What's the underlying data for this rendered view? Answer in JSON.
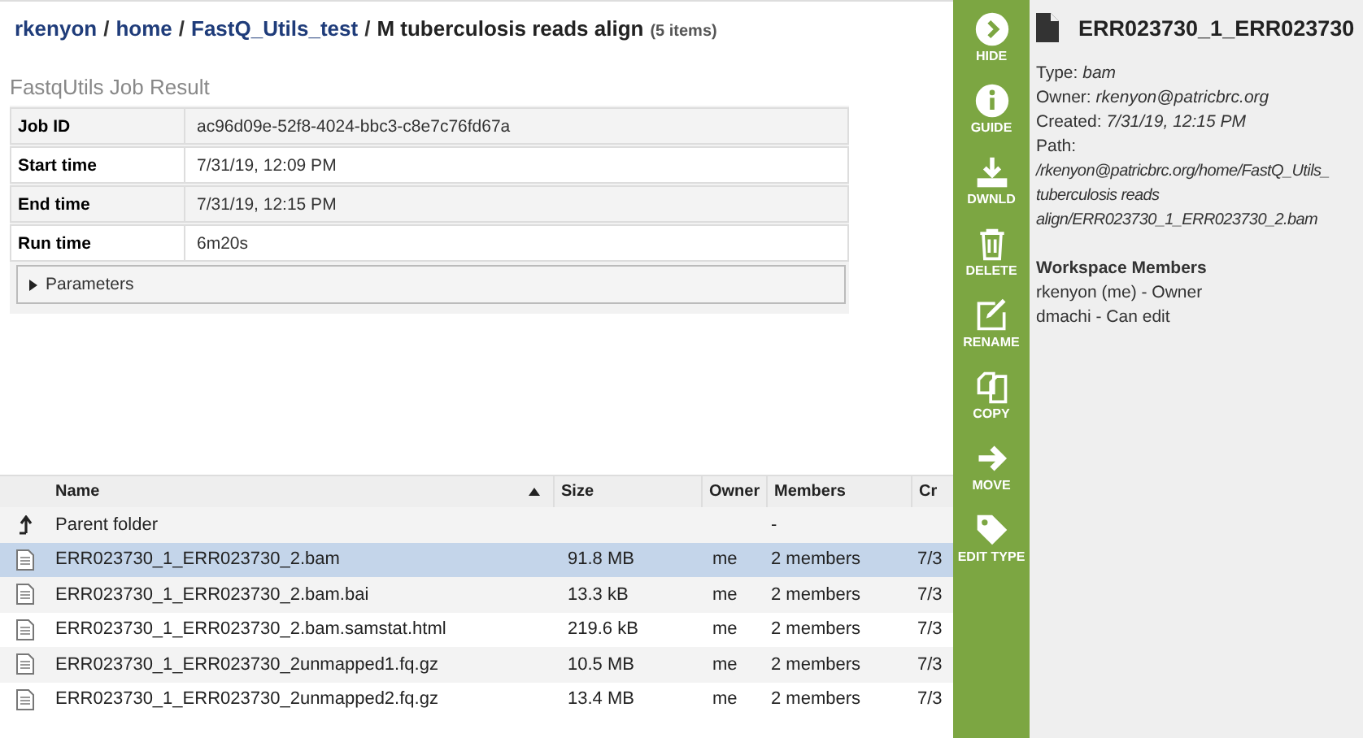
{
  "breadcrumb": {
    "separator": "/",
    "links": [
      "rkenyon",
      "home",
      "FastQ_Utils_test"
    ],
    "current": "M tuberculosis reads align",
    "count": "(5 items)"
  },
  "job_result": {
    "title": "FastqUtils Job Result",
    "rows": [
      {
        "label": "Job ID",
        "value": "ac96d09e-52f8-4024-bbc3-c8e7c76fd67a"
      },
      {
        "label": "Start time",
        "value": "7/31/19, 12:09 PM"
      },
      {
        "label": "End time",
        "value": "7/31/19, 12:15 PM"
      },
      {
        "label": "Run time",
        "value": "6m20s"
      }
    ],
    "parameters": {
      "label": "Parameters",
      "expanded": false
    }
  },
  "file_table": {
    "columns": [
      "Name",
      "Size",
      "Owner",
      "Members",
      "Cr"
    ],
    "rows": [
      {
        "kind": "parent",
        "name": "Parent folder",
        "size": "",
        "owner": "",
        "members": "-",
        "created": "",
        "selected": false
      },
      {
        "kind": "file",
        "name": "ERR023730_1_ERR023730_2.bam",
        "size": "91.8 MB",
        "owner": "me",
        "members": "2 members",
        "created": "7/3",
        "selected": true
      },
      {
        "kind": "file",
        "name": "ERR023730_1_ERR023730_2.bam.bai",
        "size": "13.3 kB",
        "owner": "me",
        "members": "2 members",
        "created": "7/3",
        "selected": false
      },
      {
        "kind": "file",
        "name": "ERR023730_1_ERR023730_2.bam.samstat.html",
        "size": "219.6 kB",
        "owner": "me",
        "members": "2 members",
        "created": "7/3",
        "selected": false
      },
      {
        "kind": "file",
        "name": "ERR023730_1_ERR023730_2unmapped1.fq.gz",
        "size": "10.5 MB",
        "owner": "me",
        "members": "2 members",
        "created": "7/3",
        "selected": false
      },
      {
        "kind": "file",
        "name": "ERR023730_1_ERR023730_2unmapped2.fq.gz",
        "size": "13.4 MB",
        "owner": "me",
        "members": "2 members",
        "created": "7/3",
        "selected": false
      }
    ]
  },
  "action_bar": [
    {
      "kind": "hide",
      "label": "HIDE"
    },
    {
      "kind": "guide",
      "label": "GUIDE"
    },
    {
      "kind": "download",
      "label": "DWNLD"
    },
    {
      "kind": "delete",
      "label": "DELETE"
    },
    {
      "kind": "rename",
      "label": "RENAME"
    },
    {
      "kind": "copy",
      "label": "COPY"
    },
    {
      "kind": "move",
      "label": "MOVE"
    },
    {
      "kind": "edittype",
      "label": "EDIT TYPE"
    }
  ],
  "details": {
    "title": "ERR023730_1_ERR023730",
    "fields": [
      {
        "label": "Type:",
        "value": "bam"
      },
      {
        "label": "Owner:",
        "value": "rkenyon@patricbrc.org"
      },
      {
        "label": "Created:",
        "value": "7/31/19, 12:15 PM"
      }
    ],
    "path_label": "Path:",
    "path_lines": [
      "/rkenyon@patricbrc.org/home/FastQ_Utils_",
      "tuberculosis reads",
      "align/ERR023730_1_ERR023730_2.bam"
    ],
    "members_title": "Workspace Members",
    "members": [
      "rkenyon (me) - Owner",
      "dmachi - Can edit"
    ]
  }
}
